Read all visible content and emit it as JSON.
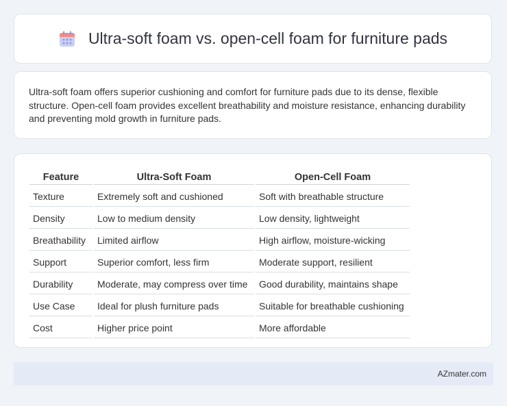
{
  "header": {
    "title": "Ultra-soft foam vs. open-cell foam for furniture pads",
    "icon": "calendar-icon",
    "icon_colors": {
      "top": "#f28b8b",
      "body": "#c9cff5",
      "dots": "#8d95e0"
    }
  },
  "summary": {
    "text": "Ultra-soft foam offers superior cushioning and comfort for furniture pads due to its dense, flexible structure. Open-cell foam provides excellent breathability and moisture resistance, enhancing durability and preventing mold growth in furniture pads."
  },
  "table": {
    "headers": [
      "Feature",
      "Ultra-Soft Foam",
      "Open-Cell Foam"
    ],
    "rows": [
      [
        "Texture",
        "Extremely soft and cushioned",
        "Soft with breathable structure"
      ],
      [
        "Density",
        "Low to medium density",
        "Low density, lightweight"
      ],
      [
        "Breathability",
        "Limited airflow",
        "High airflow, moisture-wicking"
      ],
      [
        "Support",
        "Superior comfort, less firm",
        "Moderate support, resilient"
      ],
      [
        "Durability",
        "Moderate, may compress over time",
        "Good durability, maintains shape"
      ],
      [
        "Use Case",
        "Ideal for plush furniture pads",
        "Suitable for breathable cushioning"
      ],
      [
        "Cost",
        "Higher price point",
        "More affordable"
      ]
    ]
  },
  "footer": {
    "site": "AZmater.com"
  }
}
